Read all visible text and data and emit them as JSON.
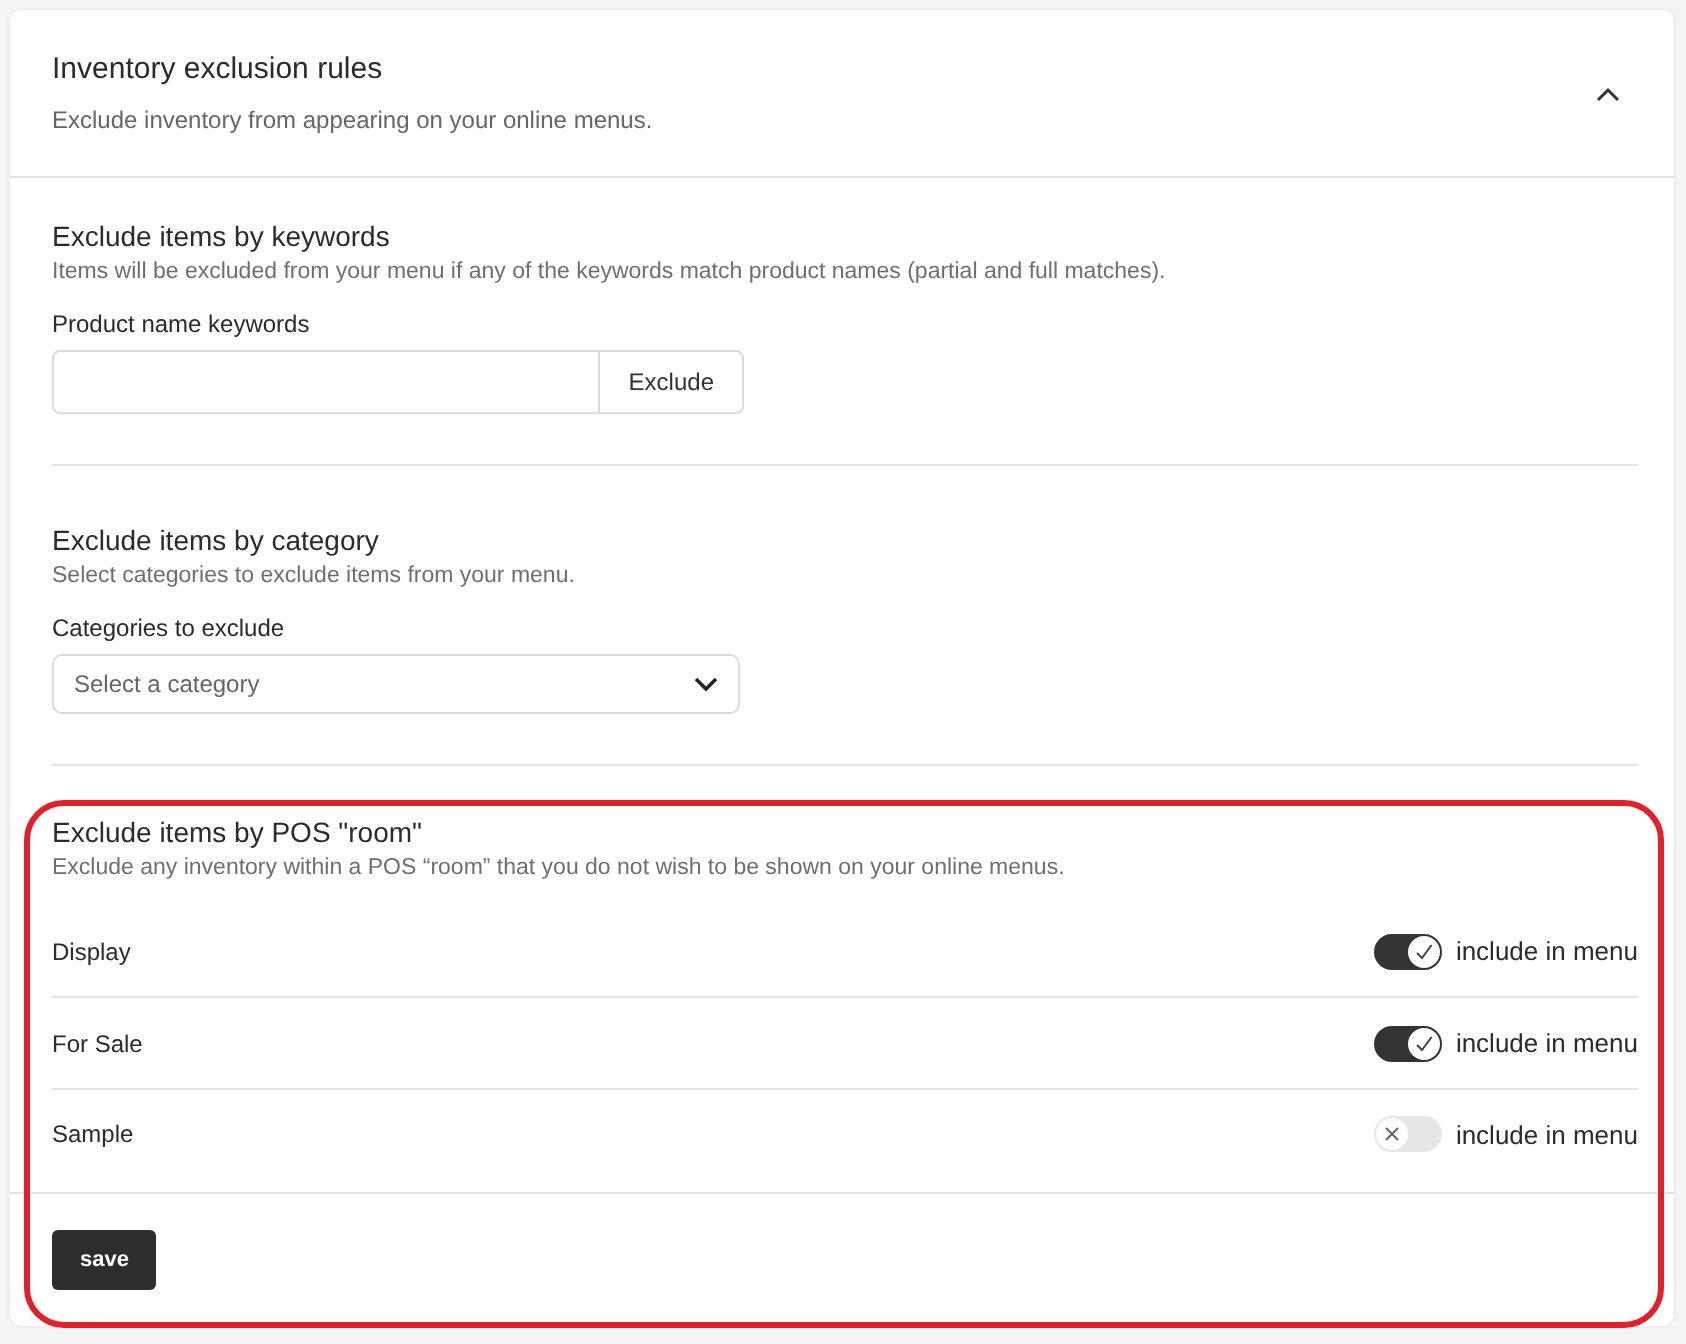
{
  "panel": {
    "title": "Inventory exclusion rules",
    "subtitle": "Exclude inventory from appearing on your online menus.",
    "expanded": true
  },
  "keywords": {
    "title": "Exclude items by keywords",
    "description": "Items will be excluded from your menu if any of the keywords match product names (partial and full matches).",
    "label": "Product name keywords",
    "button": "Exclude"
  },
  "category": {
    "title": "Exclude items by category",
    "description": "Select categories to exclude items from your menu.",
    "label": "Categories to exclude",
    "placeholder": "Select a category"
  },
  "rooms": {
    "title": "Exclude items by POS \"room\"",
    "description": "Exclude any inventory within a POS “room” that you do not wish to be shown on your online menus.",
    "highlighted": true,
    "items": [
      {
        "name": "Display",
        "on": true,
        "toggle_label": "include in menu"
      },
      {
        "name": "For Sale",
        "on": true,
        "toggle_label": "include in menu"
      },
      {
        "name": "Sample",
        "on": false,
        "toggle_label": "include in menu"
      }
    ]
  },
  "save_button": "save"
}
